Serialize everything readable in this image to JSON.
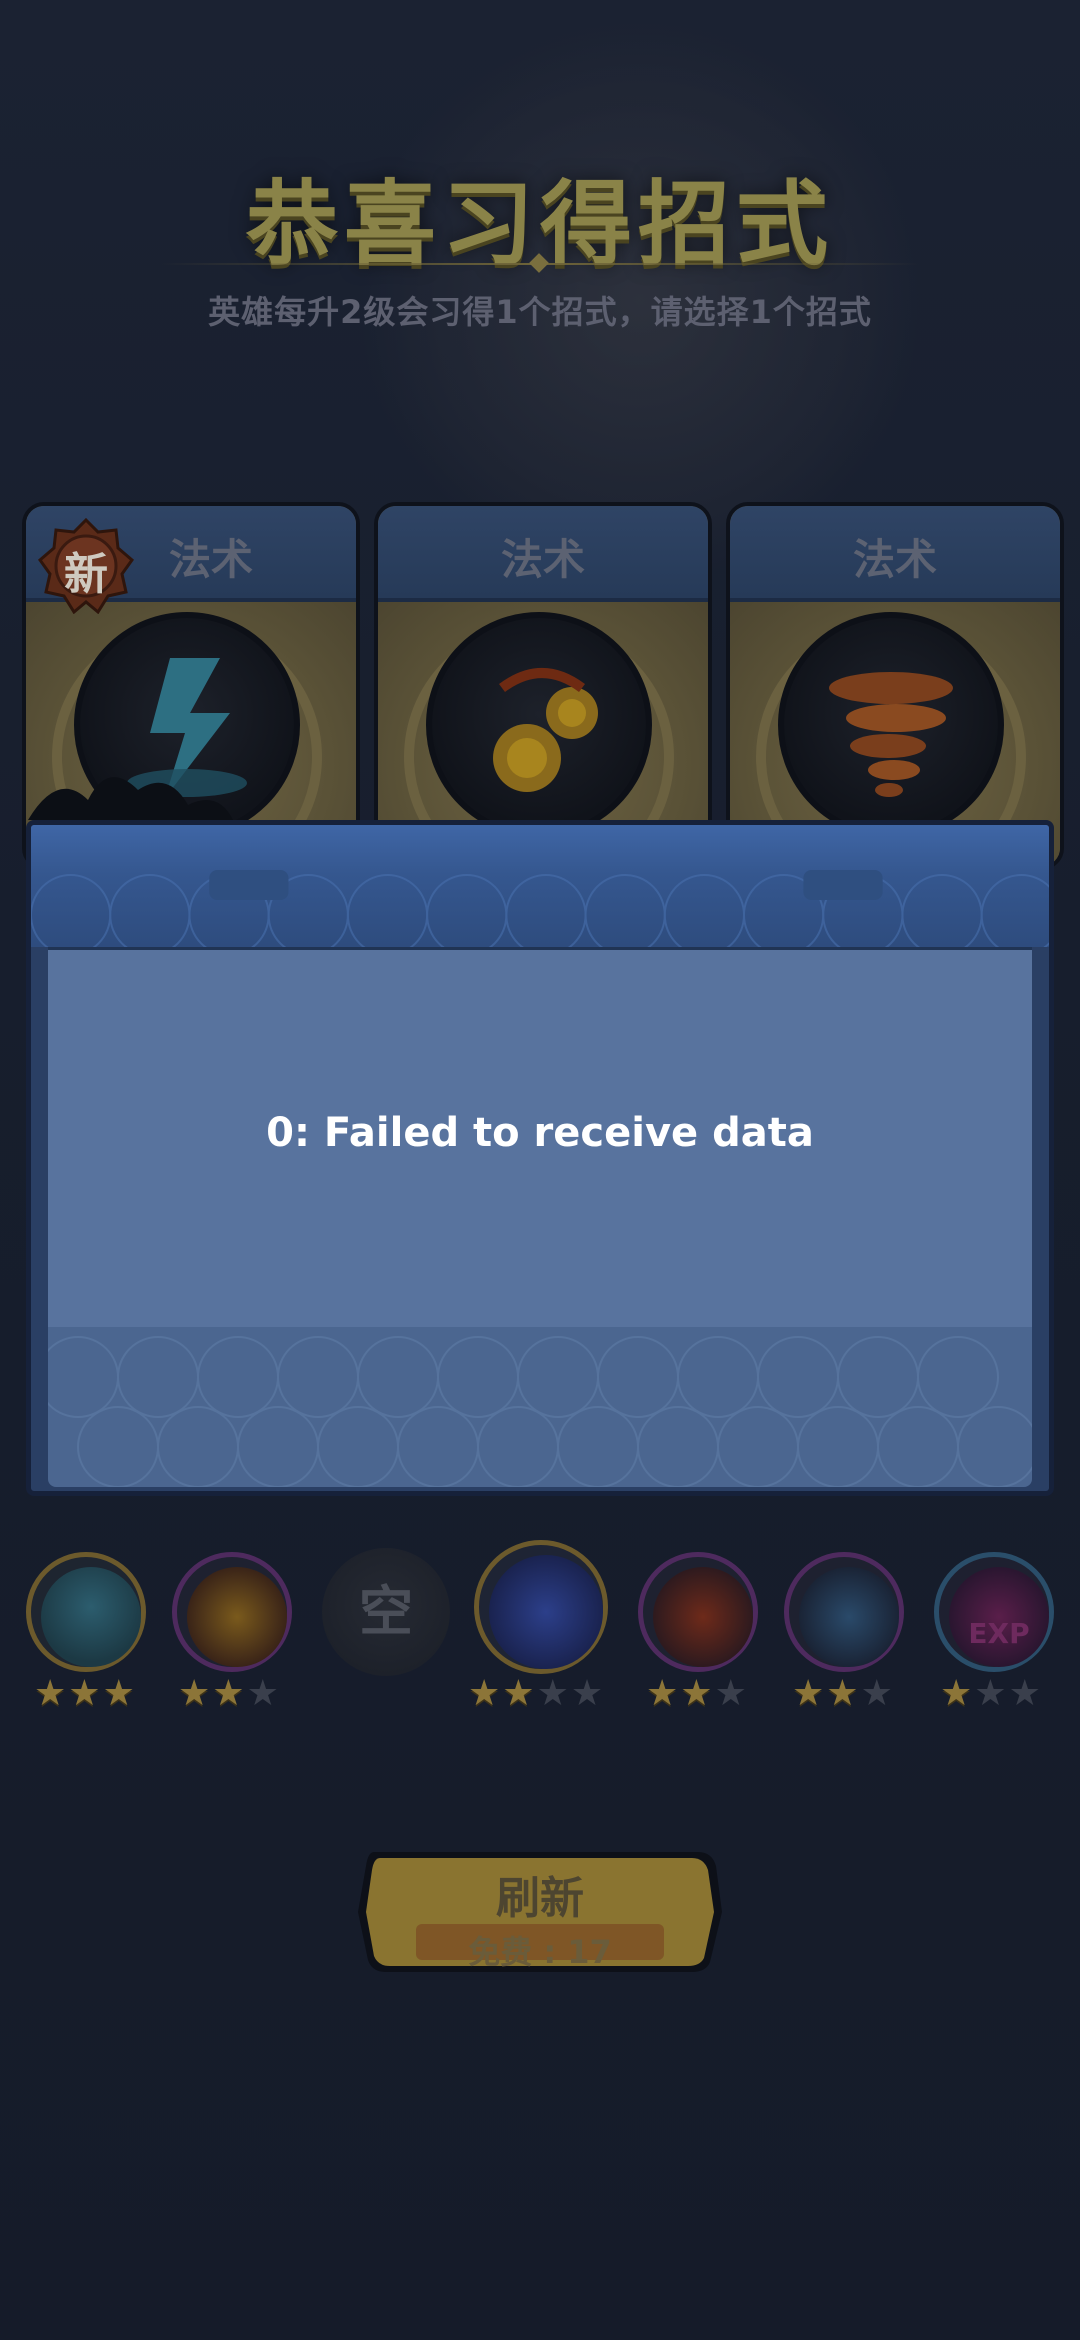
{
  "header": {
    "title": "恭喜习得招式",
    "subtitle": "英雄每升2级会习得1个招式，请选择1个招式"
  },
  "cards": [
    {
      "type_label": "法术",
      "badge": "新",
      "icon": "lightning-spell-icon"
    },
    {
      "type_label": "法术",
      "icon": "fireball-spell-icon"
    },
    {
      "type_label": "法术",
      "icon": "tornado-spell-icon"
    }
  ],
  "dialog": {
    "message": "0: Failed to receive data"
  },
  "skill_bar": {
    "empty_label": "空",
    "skills": [
      {
        "icon": "pumpkin-skill-icon",
        "stars": 3,
        "max_stars": 3
      },
      {
        "icon": "fireball-skill-icon",
        "stars": 2,
        "max_stars": 3
      },
      {
        "icon": "blue-flame-skill-icon",
        "stars": 2,
        "max_stars": 4
      },
      {
        "icon": "explosion-skill-icon",
        "stars": 2,
        "max_stars": 3
      },
      {
        "icon": "shield-orbit-skill-icon",
        "stars": 2,
        "max_stars": 3
      },
      {
        "icon": "exp-skill-icon",
        "stars": 1,
        "max_stars": 3
      }
    ],
    "exp_text": "EXP"
  },
  "refresh": {
    "label": "刷新",
    "free_label": "免费 : 17"
  },
  "colors": {
    "background": "#151b29",
    "dialog_body": "#58739e",
    "dialog_header": "#3f66a6",
    "gold_button": "#8a7430",
    "star_on": "#8c7538"
  }
}
